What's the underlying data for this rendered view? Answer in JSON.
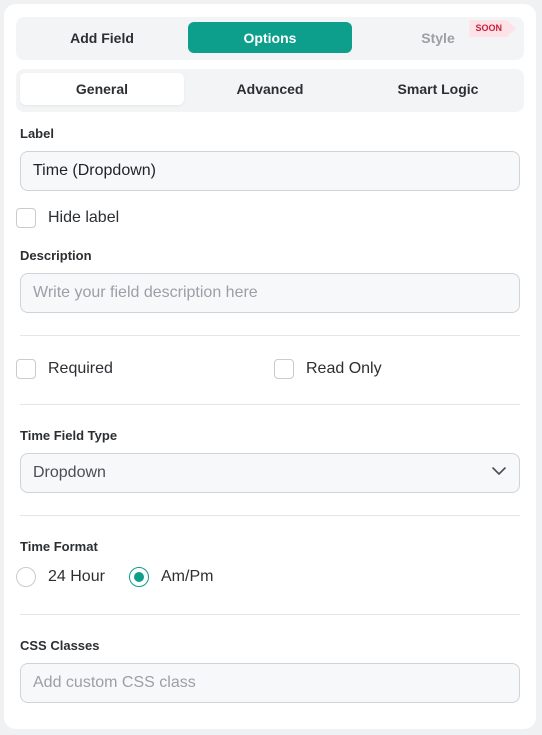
{
  "top_tabs": {
    "add_field": "Add Field",
    "options": "Options",
    "style": "Style",
    "soon_badge": "SOON"
  },
  "sub_tabs": {
    "general": "General",
    "advanced": "Advanced",
    "smart_logic": "Smart Logic"
  },
  "label_field": {
    "label": "Label",
    "value": "Time (Dropdown)"
  },
  "hide_label": {
    "label": "Hide label",
    "checked": false
  },
  "description_field": {
    "label": "Description",
    "placeholder": "Write your field description here"
  },
  "required": {
    "label": "Required",
    "checked": false
  },
  "read_only": {
    "label": "Read Only",
    "checked": false
  },
  "time_field_type": {
    "label": "Time Field Type",
    "selected": "Dropdown"
  },
  "time_format": {
    "label": "Time Format",
    "options": [
      {
        "label": "24 Hour",
        "selected": false
      },
      {
        "label": "Am/Pm",
        "selected": true
      }
    ]
  },
  "css_classes": {
    "label": "CSS Classes",
    "placeholder": "Add custom CSS class"
  },
  "colors": {
    "accent": "#0d9e8c",
    "soon_badge_bg": "#fde2e7",
    "soon_badge_text": "#c8213e"
  }
}
